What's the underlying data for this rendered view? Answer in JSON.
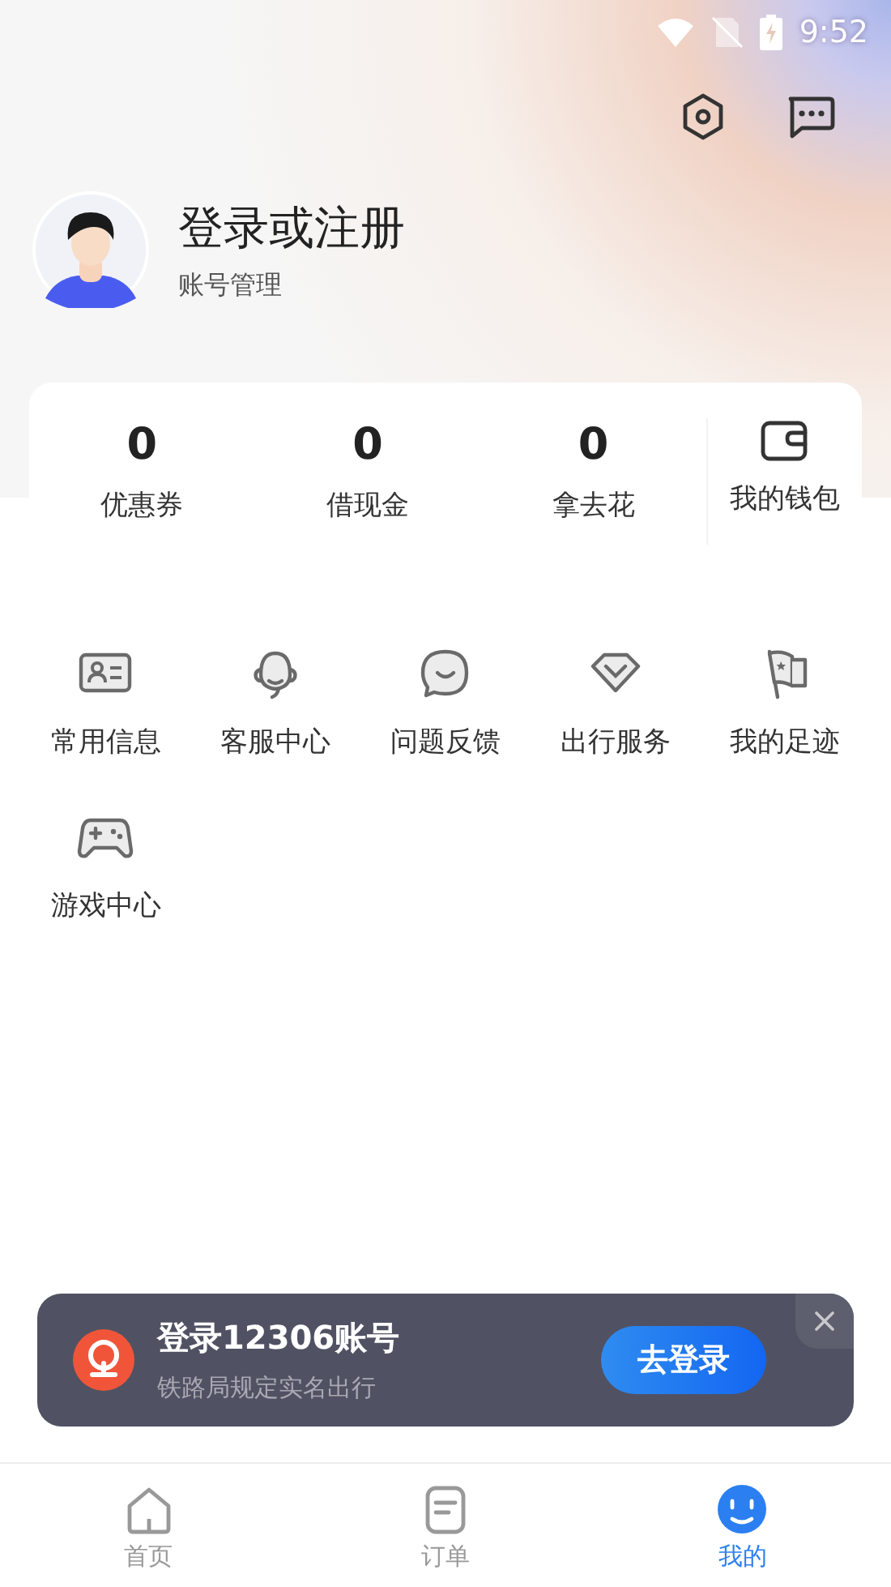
{
  "status_bar": {
    "time": "9:52"
  },
  "profile": {
    "title": "登录或注册",
    "subtitle": "账号管理"
  },
  "stats": [
    {
      "kind": "count",
      "value": "0",
      "label": "优惠券"
    },
    {
      "kind": "count",
      "value": "0",
      "label": "借现金"
    },
    {
      "kind": "count",
      "value": "0",
      "label": "拿去花"
    },
    {
      "kind": "wallet",
      "label": "我的钱包"
    }
  ],
  "menu": [
    {
      "kind": "card",
      "label": "常用信息"
    },
    {
      "kind": "headset",
      "label": "客服中心"
    },
    {
      "kind": "chat",
      "label": "问题反馈"
    },
    {
      "kind": "diamond",
      "label": "出行服务"
    },
    {
      "kind": "flag",
      "label": "我的足迹"
    },
    {
      "kind": "gamepad",
      "label": "游戏中心"
    }
  ],
  "banner": {
    "title": "登录12306账号",
    "subtitle": "铁路局规定实名出行",
    "button": "去登录"
  },
  "tabs": [
    {
      "kind": "home",
      "label": "首页",
      "selected": false
    },
    {
      "kind": "order",
      "label": "订单",
      "selected": false
    },
    {
      "kind": "me",
      "label": "我的",
      "selected": true
    }
  ]
}
